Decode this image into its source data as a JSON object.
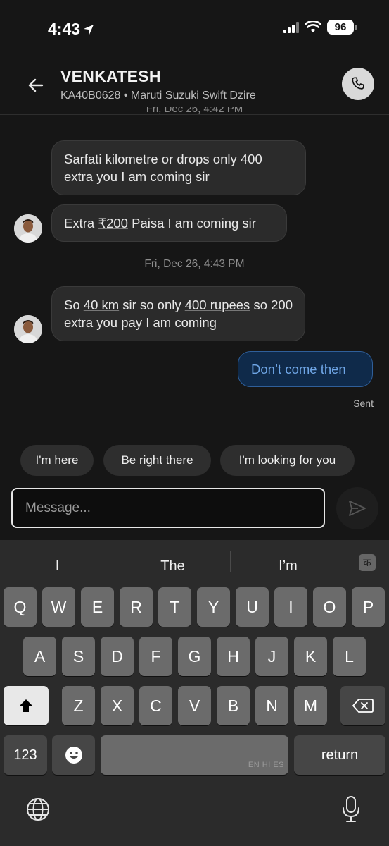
{
  "status_bar": {
    "time": "4:43",
    "battery": "96"
  },
  "header": {
    "name": "VENKATESH",
    "subtitle": "KA40B0628 • Maruti Suzuki Swift Dzire"
  },
  "chat": {
    "partial_timestamp": "Fri, Dec 26, 4:42 PM",
    "messages": [
      {
        "text": "Sarfati kilometre or drops only 400 extra you I am coming sir"
      },
      {
        "text_parts": [
          "Extra ",
          "₹200",
          " Paisa I am coming sir"
        ]
      },
      {
        "timestamp": "Fri, Dec 26, 4:43 PM"
      },
      {
        "text_parts": [
          "So ",
          "40 km",
          " sir so only ",
          "400 rupees",
          " so 200 extra you pay I am coming"
        ]
      },
      {
        "text": "Don’t come then",
        "status": "Sent"
      }
    ]
  },
  "quick_replies": [
    "I'm here",
    "Be right there",
    "I'm looking for you"
  ],
  "composer": {
    "placeholder": "Message..."
  },
  "keyboard": {
    "suggestions": [
      "I",
      "The",
      "I’m"
    ],
    "lang_key": "क",
    "row1": [
      "Q",
      "W",
      "E",
      "R",
      "T",
      "Y",
      "U",
      "I",
      "O",
      "P"
    ],
    "row2": [
      "A",
      "S",
      "D",
      "F",
      "G",
      "H",
      "J",
      "K",
      "L"
    ],
    "row3": [
      "Z",
      "X",
      "C",
      "V",
      "B",
      "N",
      "M"
    ],
    "numbers_key": "123",
    "space_hint": "EN HI ES",
    "return_key": "return"
  }
}
